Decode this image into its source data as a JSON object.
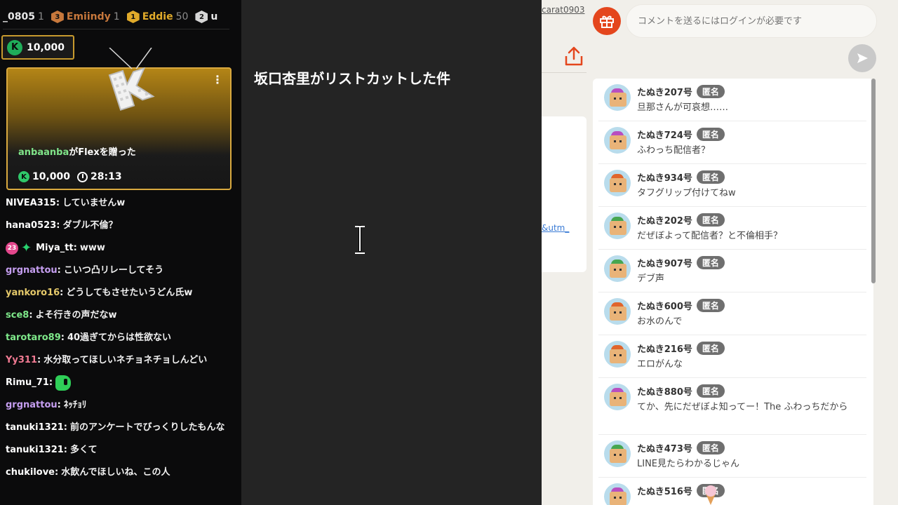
{
  "leaderboard": [
    {
      "name": "_0805",
      "count": "1",
      "rank": "",
      "color": ""
    },
    {
      "name": "Emiindy",
      "count": "1",
      "rank": "3",
      "color": "#c7783c"
    },
    {
      "name": "Eddie",
      "count": "50",
      "rank": "1",
      "color": "#e0aa2a"
    },
    {
      "name": "u",
      "count": "",
      "rank": "2",
      "color": "#d6d6d6"
    }
  ],
  "coin_badge": {
    "value": "10,000"
  },
  "gift_card": {
    "user": "anbaanba",
    "text": "がFlexを贈った",
    "amount": "10,000",
    "time": "28:13"
  },
  "chat": [
    {
      "user": "NIVEA315",
      "text": "していませんw",
      "color": "#ffffff"
    },
    {
      "user": "hana0523",
      "text": "ダブル不倫？",
      "color": "#ffffff"
    },
    {
      "user": "Miya_tt",
      "text": "www",
      "color": "#ffffff",
      "badge": "23"
    },
    {
      "user": "grgnattou",
      "text": "こいつ凸リレーしてそう",
      "color": "#c59ef0"
    },
    {
      "user": "yankoro16",
      "text": "どうしてもさせたいうどん氏w",
      "color": "#e5c96a"
    },
    {
      "user": "sce8",
      "text": "よそ行きの声だなw",
      "color": "#7ee88a"
    },
    {
      "user": "tarotaro89",
      "text": "40過ぎてからは性欲ない",
      "color": "#7ee88a"
    },
    {
      "user": "Yy311",
      "text": "水分取ってほしいネチョネチョしんどい",
      "color": "#f07a92"
    },
    {
      "user": "Rimu_71",
      "text": "",
      "color": "#ffffff",
      "emote": true
    },
    {
      "user": "grgnattou",
      "text": "ﾈｯﾁｮﾘ",
      "color": "#c59ef0"
    },
    {
      "user": "tanuki1321",
      "text": "前のアンケートでびっくりしたもんな",
      "color": "#ffffff"
    },
    {
      "user": "tanuki1321",
      "text": "多くて",
      "color": "#ffffff"
    },
    {
      "user": "chukilove",
      "text": "水飲んでほしいね、この人",
      "color": "#ffffff"
    }
  ],
  "center": {
    "title": "坂口杏里がリストカットした件"
  },
  "right": {
    "url_fragment": "carat0903",
    "utm_fragment": "&utm_",
    "comment_placeholder": "コメントを送るにはログインが必要です",
    "anon_label": "匿名",
    "comments": [
      {
        "name": "たぬき207号",
        "text": "旦那さんが可哀想……",
        "ear": "#b84fc0"
      },
      {
        "name": "たぬき724号",
        "text": "ふわっち配信者？",
        "ear": "#b84fc0"
      },
      {
        "name": "たぬき934号",
        "text": "タフグリップ付けてねw",
        "ear": "#e0652c"
      },
      {
        "name": "たぬき202号",
        "text": "だぜぼよって配信者？と不倫相手？",
        "ear": "#46a650"
      },
      {
        "name": "たぬき907号",
        "text": "デブ声",
        "ear": "#46a650"
      },
      {
        "name": "たぬき600号",
        "text": "お水のんで",
        "ear": "#e0652c"
      },
      {
        "name": "たぬき216号",
        "text": "エロがんな",
        "ear": "#e0652c"
      },
      {
        "name": "たぬき880号",
        "text": "てか、先にだぜぼよ知ってー！The ふわっちだから",
        "ear": "#b84fc0"
      },
      {
        "name": "たぬき473号",
        "text": "LINE見たらわかるじゃん",
        "ear": "#46a650"
      },
      {
        "name": "たぬき516号",
        "text": "",
        "ear": "#b84fc0"
      }
    ]
  }
}
